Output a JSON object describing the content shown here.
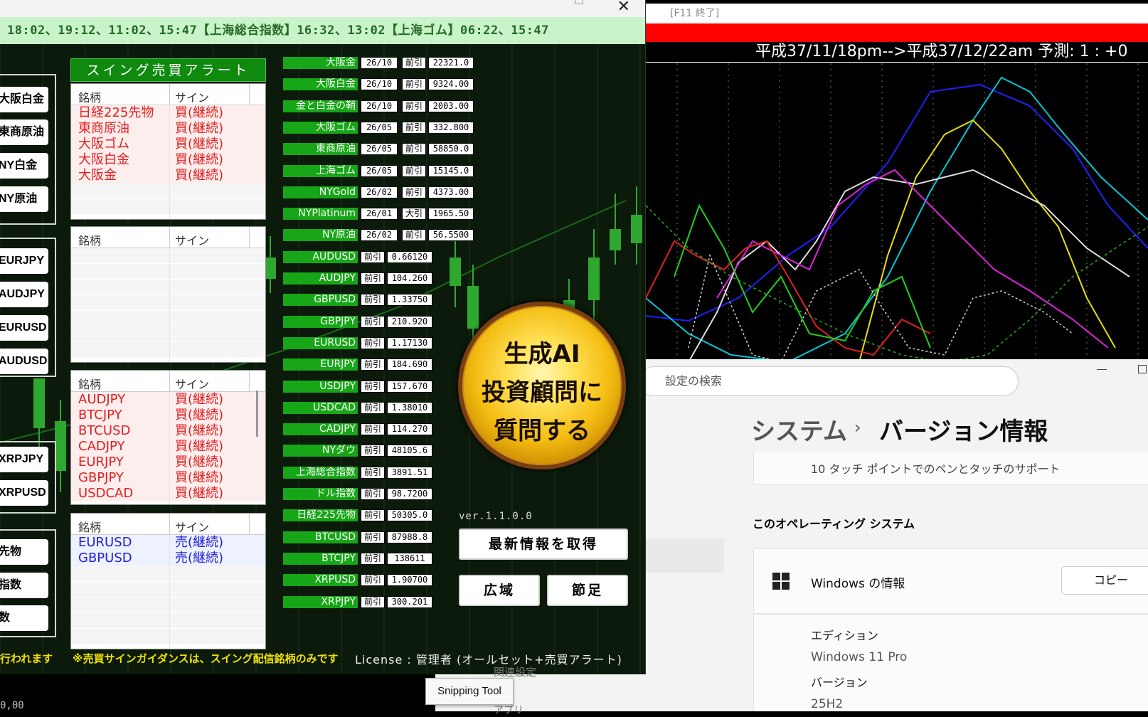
{
  "ticker": {
    "text": "18:02、19:12、11:02、15:47【上海総合指数】16:32、13:02【上海ゴム】06:22、15:47"
  },
  "left_buttons": {
    "group1": [
      "大阪白金",
      "東商原油",
      "NY白金",
      "NY原油"
    ],
    "group2": [
      "EURJPY",
      "AUDJPY",
      "EURUSD",
      "AUDUSD"
    ],
    "group3": [
      "XRPJPY",
      "XRPUSD"
    ],
    "group4": [
      "先物",
      "指数",
      "数"
    ]
  },
  "swing": {
    "title": "スイング売買アラート",
    "col_name": "銘柄",
    "col_sign": "サイン",
    "tables": [
      {
        "rows": [
          {
            "name": "日経225先物",
            "sign": "買(継続)",
            "type": "buy"
          },
          {
            "name": "東商原油",
            "sign": "買(継続)",
            "type": "buy"
          },
          {
            "name": "大阪ゴム",
            "sign": "買(継続)",
            "type": "buy"
          },
          {
            "name": "大阪白金",
            "sign": "買(継続)",
            "type": "buy"
          },
          {
            "name": "大阪金",
            "sign": "買(継続)",
            "type": "buy"
          }
        ]
      },
      {
        "rows": []
      },
      {
        "rows": [
          {
            "name": "AUDJPY",
            "sign": "買(継続)",
            "type": "buy"
          },
          {
            "name": "BTCJPY",
            "sign": "買(継続)",
            "type": "buy"
          },
          {
            "name": "BTCUSD",
            "sign": "買(継続)",
            "type": "buy"
          },
          {
            "name": "CADJPY",
            "sign": "買(継続)",
            "type": "buy"
          },
          {
            "name": "EURJPY",
            "sign": "買(継続)",
            "type": "buy"
          },
          {
            "name": "GBPJPY",
            "sign": "買(継続)",
            "type": "buy"
          },
          {
            "name": "USDCAD",
            "sign": "買(継続)",
            "type": "buy"
          }
        ]
      },
      {
        "rows": [
          {
            "name": "EURUSD",
            "sign": "売(継続)",
            "type": "sell"
          },
          {
            "name": "GBPUSD",
            "sign": "売(継続)",
            "type": "sell"
          }
        ]
      }
    ]
  },
  "prices": [
    {
      "name": "大阪金",
      "month": "26/10",
      "kind": "前引",
      "value": "22321.0"
    },
    {
      "name": "大阪白金",
      "month": "26/10",
      "kind": "前引",
      "value": "9324.00"
    },
    {
      "name": "金と白金の鞘",
      "month": "26/10",
      "kind": "前引",
      "value": "2003.00"
    },
    {
      "name": "大阪ゴム",
      "month": "26/05",
      "kind": "前引",
      "value": "332.800"
    },
    {
      "name": "東商原油",
      "month": "26/05",
      "kind": "前引",
      "value": "58850.0"
    },
    {
      "name": "上海ゴム",
      "month": "26/05",
      "kind": "前引",
      "value": "15145.0"
    },
    {
      "name": "NYGold",
      "month": "26/02",
      "kind": "前引",
      "value": "4373.00"
    },
    {
      "name": "NYPlatinum",
      "month": "26/01",
      "kind": "大引",
      "value": "1965.50"
    },
    {
      "name": "NY原油",
      "month": "26/02",
      "kind": "前引",
      "value": "56.5500"
    },
    {
      "name": "AUDUSD",
      "month": "",
      "kind": "前引",
      "value": "0.66120"
    },
    {
      "name": "AUDJPY",
      "month": "",
      "kind": "前引",
      "value": "104.260"
    },
    {
      "name": "GBPUSD",
      "month": "",
      "kind": "前引",
      "value": "1.33750"
    },
    {
      "name": "GBPJPY",
      "month": "",
      "kind": "前引",
      "value": "210.920"
    },
    {
      "name": "EURUSD",
      "month": "",
      "kind": "前引",
      "value": "1.17130"
    },
    {
      "name": "EURJPY",
      "month": "",
      "kind": "前引",
      "value": "184.690"
    },
    {
      "name": "USDJPY",
      "month": "",
      "kind": "前引",
      "value": "157.670"
    },
    {
      "name": "USDCAD",
      "month": "",
      "kind": "前引",
      "value": "1.38010"
    },
    {
      "name": "CADJPY",
      "month": "",
      "kind": "前引",
      "value": "114.270"
    },
    {
      "name": "NYダウ",
      "month": "",
      "kind": "前引",
      "value": "48105.6"
    },
    {
      "name": "上海総合指数",
      "month": "",
      "kind": "前引",
      "value": "3891.51"
    },
    {
      "name": "ドル指数",
      "month": "",
      "kind": "前引",
      "value": "98.7200"
    },
    {
      "name": "日経225先物",
      "month": "",
      "kind": "前引",
      "value": "50305.0"
    },
    {
      "name": "BTCUSD",
      "month": "",
      "kind": "前引",
      "value": "87988.8"
    },
    {
      "name": "BTCJPY",
      "month": "",
      "kind": "前引",
      "value": "138611"
    },
    {
      "name": "XRPUSD",
      "month": "",
      "kind": "前引",
      "value": "1.90700"
    },
    {
      "name": "XRPJPY",
      "month": "",
      "kind": "前引",
      "value": "300.201"
    }
  ],
  "ai": {
    "line1": "生成AI",
    "line2": "投資顧問に",
    "line3": "質問する"
  },
  "version": "ver.1.1.0.0",
  "buttons": {
    "refresh": "最新情報を取得",
    "wide": "広域",
    "season": "節足"
  },
  "footer": {
    "warn_left": "行われます",
    "warn": "※売買サインガイダンスは、スイング配信銘柄のみです",
    "license": "License : 管理者 (オールセット+売買アラート)"
  },
  "osc": {
    "bar_text": "[F11 終了]",
    "header": "平成37/11/18pm-->平成37/12/22am 予測: 1 : +0",
    "colors": {
      "blue": "#2020ff",
      "cyan": "#00c8d8",
      "yellow": "#e8e000",
      "white": "#dddddd",
      "magenta": "#e020e0",
      "red": "#e02020",
      "green": "#20d020"
    }
  },
  "settings": {
    "search_placeholder": "設定の検索",
    "crumb1": "システム",
    "crumb2": "バージョン情報",
    "touch_text": "10 タッチ ポイントでのペンとタッチのサポート",
    "os_section": "このオペレーティング システム",
    "win_info": "Windows の情報",
    "copy": "コピー",
    "edition_label": "エディション",
    "edition_value": "Windows 11 Pro",
    "version_label": "バージョン",
    "version_value": "25H2"
  },
  "taskbar": {
    "tooltip": "Snipping Tool",
    "ghost1": "関連設定",
    "ghost2": "アプリ",
    "left_label": "0,00"
  }
}
